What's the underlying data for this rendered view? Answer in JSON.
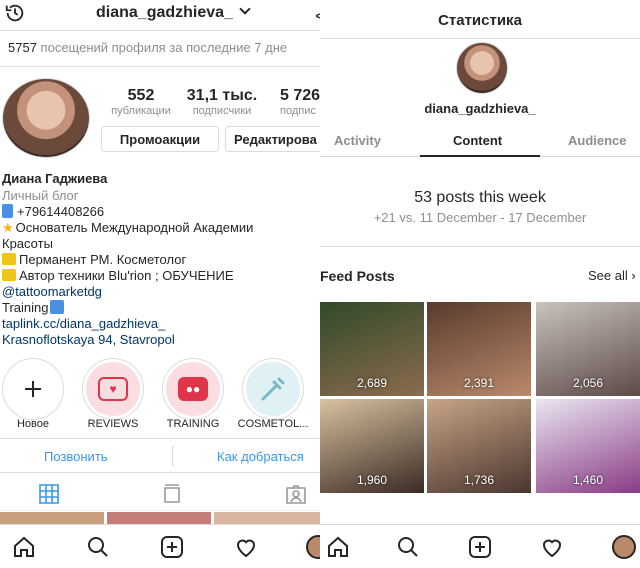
{
  "left": {
    "header": {
      "username": "diana_gadzhieva_",
      "close_glyph": "<"
    },
    "visits_count": "5757",
    "visits_text": "посещений профиля за последние 7 дне",
    "stats": [
      {
        "value": "552",
        "label": "публикации"
      },
      {
        "value": "31,1 тыс.",
        "label": "подписчики"
      },
      {
        "value": "5 726",
        "label": "подпис"
      }
    ],
    "buttons": {
      "promo": "Промоакции",
      "edit": "Редактирова"
    },
    "bio": {
      "name": "Диана Гаджиева",
      "category": "Личный блог",
      "phone": "+79614408266",
      "line_founder": "Основатель Международной Академии",
      "line_beauty": "Красоты",
      "line_permanent": "Перманент РМ. Косметолог",
      "line_author": "Автор техники Blu'rion ; ОБУЧЕНИЕ",
      "mention": "@tattoomarketdg",
      "training": "Training",
      "link": "taplink.cc/diana_gadzhieva_",
      "address": "Krasnoflotskaya 94, Stavropol"
    },
    "highlights": [
      {
        "label": "Новое",
        "icon": "plus-icon"
      },
      {
        "label": "REVIEWS",
        "icon": "chat-heart-icon"
      },
      {
        "label": "TRAINING",
        "icon": "video-icon"
      },
      {
        "label": "COSMETOL...",
        "icon": "syringe-icon"
      }
    ],
    "actions": {
      "call": "Позвонить",
      "directions": "Как добраться"
    }
  },
  "right": {
    "title": "Статистика",
    "username": "diana_gadzhieva_",
    "tabs": [
      "Activity",
      "Content",
      "Audience"
    ],
    "active_tab": "Content",
    "posts_week": "53 posts this week",
    "posts_delta": "+21 vs. 11 December - 17 December",
    "feed_title": "Feed Posts",
    "see_all": "See all",
    "feed": [
      {
        "value": "2,689",
        "colors": [
          "#2f4a2a",
          "#8d6b4e"
        ]
      },
      {
        "value": "2,391",
        "colors": [
          "#5a3a2e",
          "#b98a6a"
        ]
      },
      {
        "value": "2,056",
        "colors": [
          "#c9c2bc",
          "#5d4a49"
        ]
      },
      {
        "value": "1,960",
        "colors": [
          "#d9c2a0",
          "#3a2a24"
        ]
      },
      {
        "value": "1,736",
        "colors": [
          "#c7a485",
          "#4a3630"
        ]
      },
      {
        "value": "1,460",
        "colors": [
          "#e9e6f0",
          "#8a3b86"
        ]
      }
    ]
  },
  "colors": {
    "link": "#003569",
    "action": "#3897f0",
    "muted": "#8e8e8e",
    "border": "#dbdbdb"
  }
}
